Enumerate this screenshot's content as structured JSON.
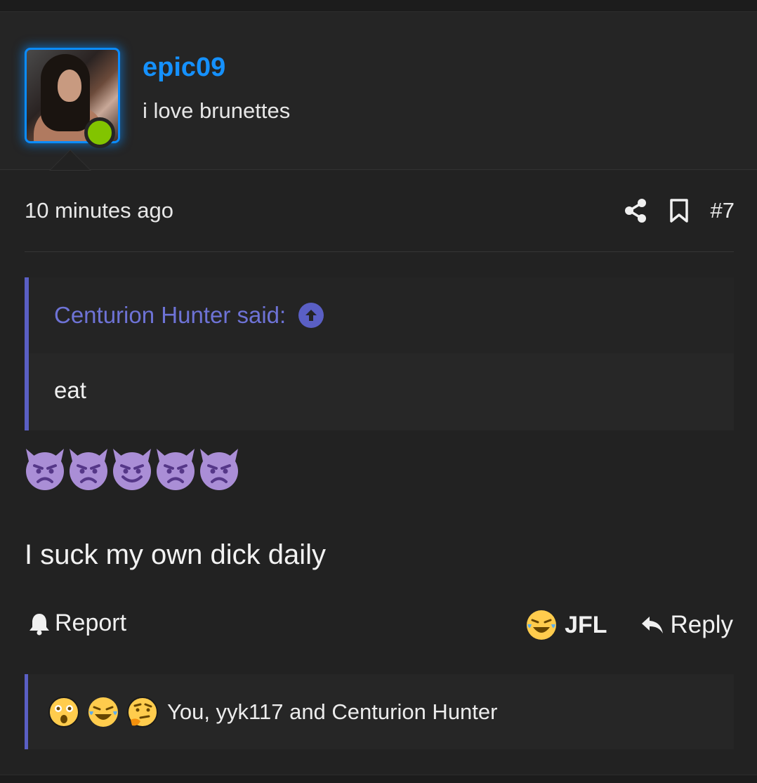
{
  "user": {
    "name": "epic09",
    "title": "i love brunettes",
    "status_color": "#82c400",
    "name_color": "#1591ff"
  },
  "post": {
    "time": "10 minutes ago",
    "number": "#7",
    "quote": {
      "author": "Centurion Hunter said:",
      "body": "eat"
    },
    "emoji_count": 5,
    "message": "I suck my own dick daily"
  },
  "footer": {
    "report_label": "Report",
    "reaction_label": "JFL",
    "reply_label": "Reply"
  },
  "reactions": {
    "icons": [
      "astonished-icon",
      "joy-icon",
      "thinking-icon"
    ],
    "summary": "You, yyk117 and Centurion Hunter"
  },
  "colors": {
    "accent": "#5a5fc4",
    "background": "#222222"
  }
}
